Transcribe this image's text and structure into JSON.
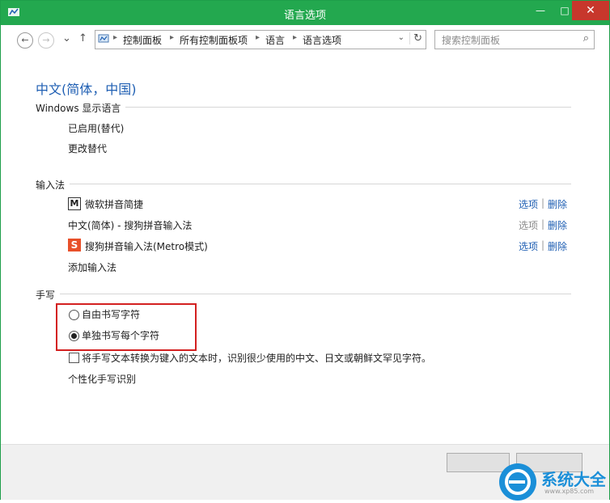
{
  "window": {
    "title": "语言选项"
  },
  "nav": {
    "back_icon": "back-arrow-icon",
    "forward_icon": "forward-arrow-icon",
    "up_icon": "up-arrow-icon",
    "breadcrumb": [
      "控制面板",
      "所有控制面板项",
      "语言",
      "语言选项"
    ],
    "search_placeholder": "搜索控制面板"
  },
  "page": {
    "heading": "中文(简体，中国)",
    "display_language": {
      "title": "Windows 显示语言",
      "status": "已启用(替代)",
      "change_link": "更改替代"
    },
    "input_method": {
      "title": "输入法",
      "items": [
        {
          "name": "微软拼音简捷",
          "options": "选项",
          "remove": "删除",
          "options_enabled": true
        },
        {
          "name": "中文(简体) - 搜狗拼音输入法",
          "options": "选项",
          "remove": "删除",
          "options_enabled": false
        },
        {
          "name": "搜狗拼音输入法(Metro模式)",
          "options": "选项",
          "remove": "删除",
          "options_enabled": true
        }
      ],
      "add_link": "添加输入法"
    },
    "handwriting": {
      "title": "手写",
      "radio_free": "自由书写字符",
      "radio_single": "单独书写每个字符",
      "selected": "单独书写每个字符",
      "checkbox_label": "将手写文本转换为键入的文本时，识别很少使用的中文、日文或朝鲜文罕见字符。",
      "checkbox_checked": false,
      "personalize_link": "个性化手写识别"
    }
  },
  "watermark": {
    "text": "系统大全",
    "sub": "www.xp85.com"
  },
  "colors": {
    "titlebar": "#23a84f",
    "link": "#1f5fb3",
    "highlight": "#d32020",
    "close": "#c7372c"
  }
}
